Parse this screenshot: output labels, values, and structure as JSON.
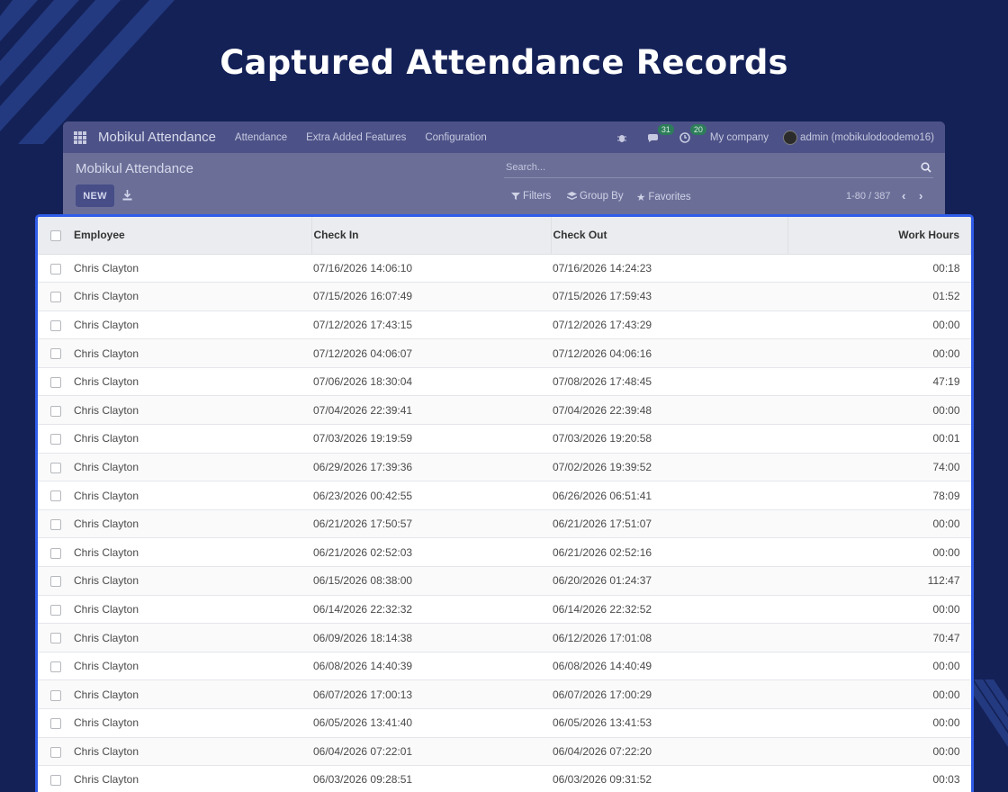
{
  "page": {
    "title": "Captured Attendance Records"
  },
  "navbar": {
    "brand": "Mobikul Attendance",
    "menu": [
      "Attendance",
      "Extra Added Features",
      "Configuration"
    ],
    "messages_count": "31",
    "activities_count": "20",
    "company": "My company",
    "user": "admin (mobikulodoodemo16)"
  },
  "control": {
    "breadcrumb": "Mobikul Attendance",
    "new_label": "NEW",
    "search_placeholder": "Search...",
    "filters_label": "Filters",
    "groupby_label": "Group By",
    "favorites_label": "Favorites",
    "pager": "1-80 / 387"
  },
  "table": {
    "headers": {
      "employee": "Employee",
      "check_in": "Check In",
      "check_out": "Check Out",
      "work_hours": "Work Hours"
    },
    "rows": [
      {
        "employee": "Chris Clayton",
        "check_in": "07/16/2026 14:06:10",
        "check_out": "07/16/2026 14:24:23",
        "work_hours": "00:18"
      },
      {
        "employee": "Chris Clayton",
        "check_in": "07/15/2026 16:07:49",
        "check_out": "07/15/2026 17:59:43",
        "work_hours": "01:52"
      },
      {
        "employee": "Chris Clayton",
        "check_in": "07/12/2026 17:43:15",
        "check_out": "07/12/2026 17:43:29",
        "work_hours": "00:00"
      },
      {
        "employee": "Chris Clayton",
        "check_in": "07/12/2026 04:06:07",
        "check_out": "07/12/2026 04:06:16",
        "work_hours": "00:00"
      },
      {
        "employee": "Chris Clayton",
        "check_in": "07/06/2026 18:30:04",
        "check_out": "07/08/2026 17:48:45",
        "work_hours": "47:19"
      },
      {
        "employee": "Chris Clayton",
        "check_in": "07/04/2026 22:39:41",
        "check_out": "07/04/2026 22:39:48",
        "work_hours": "00:00"
      },
      {
        "employee": "Chris Clayton",
        "check_in": "07/03/2026 19:19:59",
        "check_out": "07/03/2026 19:20:58",
        "work_hours": "00:01"
      },
      {
        "employee": "Chris Clayton",
        "check_in": "06/29/2026 17:39:36",
        "check_out": "07/02/2026 19:39:52",
        "work_hours": "74:00"
      },
      {
        "employee": "Chris Clayton",
        "check_in": "06/23/2026 00:42:55",
        "check_out": "06/26/2026 06:51:41",
        "work_hours": "78:09"
      },
      {
        "employee": "Chris Clayton",
        "check_in": "06/21/2026 17:50:57",
        "check_out": "06/21/2026 17:51:07",
        "work_hours": "00:00"
      },
      {
        "employee": "Chris Clayton",
        "check_in": "06/21/2026 02:52:03",
        "check_out": "06/21/2026 02:52:16",
        "work_hours": "00:00"
      },
      {
        "employee": "Chris Clayton",
        "check_in": "06/15/2026 08:38:00",
        "check_out": "06/20/2026 01:24:37",
        "work_hours": "112:47"
      },
      {
        "employee": "Chris Clayton",
        "check_in": "06/14/2026 22:32:32",
        "check_out": "06/14/2026 22:32:52",
        "work_hours": "00:00"
      },
      {
        "employee": "Chris Clayton",
        "check_in": "06/09/2026 18:14:38",
        "check_out": "06/12/2026 17:01:08",
        "work_hours": "70:47"
      },
      {
        "employee": "Chris Clayton",
        "check_in": "06/08/2026 14:40:39",
        "check_out": "06/08/2026 14:40:49",
        "work_hours": "00:00"
      },
      {
        "employee": "Chris Clayton",
        "check_in": "06/07/2026 17:00:13",
        "check_out": "06/07/2026 17:00:29",
        "work_hours": "00:00"
      },
      {
        "employee": "Chris Clayton",
        "check_in": "06/05/2026 13:41:40",
        "check_out": "06/05/2026 13:41:53",
        "work_hours": "00:00"
      },
      {
        "employee": "Chris Clayton",
        "check_in": "06/04/2026 07:22:01",
        "check_out": "06/04/2026 07:22:20",
        "work_hours": "00:00"
      },
      {
        "employee": "Chris Clayton",
        "check_in": "06/03/2026 09:28:51",
        "check_out": "06/03/2026 09:31:52",
        "work_hours": "00:03"
      }
    ]
  },
  "colors": {
    "background": "#142157",
    "navbar": "#4c5287",
    "highlight_border": "#2f5ce8"
  }
}
